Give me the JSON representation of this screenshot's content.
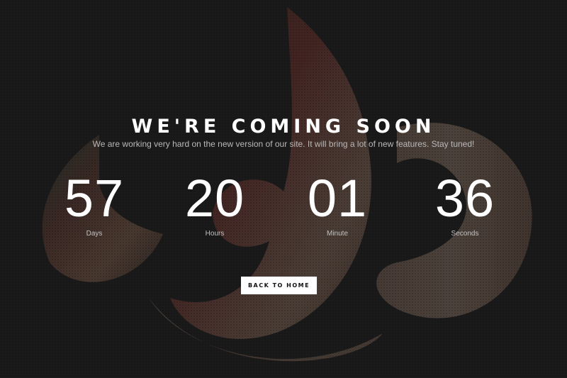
{
  "hero": {
    "title": "WE'RE COMING SOON",
    "subtitle": "We are working very hard on the new version of our site. It will bring a lot of new features. Stay tuned!"
  },
  "countdown": [
    {
      "value": "57",
      "label": "Days"
    },
    {
      "value": "20",
      "label": "Hours"
    },
    {
      "value": "01",
      "label": "Minute"
    },
    {
      "value": "36",
      "label": "Seconds"
    }
  ],
  "actions": {
    "back_home_label": "BACK TO HOME"
  },
  "colors": {
    "background": "#202021",
    "text": "#ffffff",
    "muted_text": "#b9b9b9",
    "button_bg": "#ffffff",
    "button_text": "#111111"
  }
}
